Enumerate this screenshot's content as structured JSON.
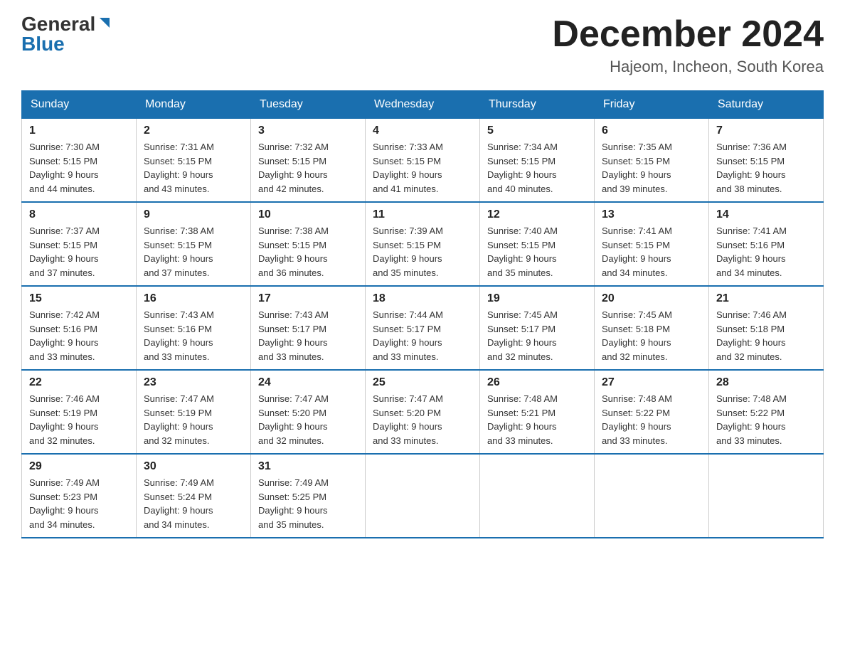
{
  "header": {
    "logo_general": "General",
    "logo_blue": "Blue",
    "month_year": "December 2024",
    "location": "Hajeom, Incheon, South Korea"
  },
  "weekdays": [
    "Sunday",
    "Monday",
    "Tuesday",
    "Wednesday",
    "Thursday",
    "Friday",
    "Saturday"
  ],
  "weeks": [
    [
      {
        "day": "1",
        "sunrise": "7:30 AM",
        "sunset": "5:15 PM",
        "daylight": "9 hours and 44 minutes."
      },
      {
        "day": "2",
        "sunrise": "7:31 AM",
        "sunset": "5:15 PM",
        "daylight": "9 hours and 43 minutes."
      },
      {
        "day": "3",
        "sunrise": "7:32 AM",
        "sunset": "5:15 PM",
        "daylight": "9 hours and 42 minutes."
      },
      {
        "day": "4",
        "sunrise": "7:33 AM",
        "sunset": "5:15 PM",
        "daylight": "9 hours and 41 minutes."
      },
      {
        "day": "5",
        "sunrise": "7:34 AM",
        "sunset": "5:15 PM",
        "daylight": "9 hours and 40 minutes."
      },
      {
        "day": "6",
        "sunrise": "7:35 AM",
        "sunset": "5:15 PM",
        "daylight": "9 hours and 39 minutes."
      },
      {
        "day": "7",
        "sunrise": "7:36 AM",
        "sunset": "5:15 PM",
        "daylight": "9 hours and 38 minutes."
      }
    ],
    [
      {
        "day": "8",
        "sunrise": "7:37 AM",
        "sunset": "5:15 PM",
        "daylight": "9 hours and 37 minutes."
      },
      {
        "day": "9",
        "sunrise": "7:38 AM",
        "sunset": "5:15 PM",
        "daylight": "9 hours and 37 minutes."
      },
      {
        "day": "10",
        "sunrise": "7:38 AM",
        "sunset": "5:15 PM",
        "daylight": "9 hours and 36 minutes."
      },
      {
        "day": "11",
        "sunrise": "7:39 AM",
        "sunset": "5:15 PM",
        "daylight": "9 hours and 35 minutes."
      },
      {
        "day": "12",
        "sunrise": "7:40 AM",
        "sunset": "5:15 PM",
        "daylight": "9 hours and 35 minutes."
      },
      {
        "day": "13",
        "sunrise": "7:41 AM",
        "sunset": "5:15 PM",
        "daylight": "9 hours and 34 minutes."
      },
      {
        "day": "14",
        "sunrise": "7:41 AM",
        "sunset": "5:16 PM",
        "daylight": "9 hours and 34 minutes."
      }
    ],
    [
      {
        "day": "15",
        "sunrise": "7:42 AM",
        "sunset": "5:16 PM",
        "daylight": "9 hours and 33 minutes."
      },
      {
        "day": "16",
        "sunrise": "7:43 AM",
        "sunset": "5:16 PM",
        "daylight": "9 hours and 33 minutes."
      },
      {
        "day": "17",
        "sunrise": "7:43 AM",
        "sunset": "5:17 PM",
        "daylight": "9 hours and 33 minutes."
      },
      {
        "day": "18",
        "sunrise": "7:44 AM",
        "sunset": "5:17 PM",
        "daylight": "9 hours and 33 minutes."
      },
      {
        "day": "19",
        "sunrise": "7:45 AM",
        "sunset": "5:17 PM",
        "daylight": "9 hours and 32 minutes."
      },
      {
        "day": "20",
        "sunrise": "7:45 AM",
        "sunset": "5:18 PM",
        "daylight": "9 hours and 32 minutes."
      },
      {
        "day": "21",
        "sunrise": "7:46 AM",
        "sunset": "5:18 PM",
        "daylight": "9 hours and 32 minutes."
      }
    ],
    [
      {
        "day": "22",
        "sunrise": "7:46 AM",
        "sunset": "5:19 PM",
        "daylight": "9 hours and 32 minutes."
      },
      {
        "day": "23",
        "sunrise": "7:47 AM",
        "sunset": "5:19 PM",
        "daylight": "9 hours and 32 minutes."
      },
      {
        "day": "24",
        "sunrise": "7:47 AM",
        "sunset": "5:20 PM",
        "daylight": "9 hours and 32 minutes."
      },
      {
        "day": "25",
        "sunrise": "7:47 AM",
        "sunset": "5:20 PM",
        "daylight": "9 hours and 33 minutes."
      },
      {
        "day": "26",
        "sunrise": "7:48 AM",
        "sunset": "5:21 PM",
        "daylight": "9 hours and 33 minutes."
      },
      {
        "day": "27",
        "sunrise": "7:48 AM",
        "sunset": "5:22 PM",
        "daylight": "9 hours and 33 minutes."
      },
      {
        "day": "28",
        "sunrise": "7:48 AM",
        "sunset": "5:22 PM",
        "daylight": "9 hours and 33 minutes."
      }
    ],
    [
      {
        "day": "29",
        "sunrise": "7:49 AM",
        "sunset": "5:23 PM",
        "daylight": "9 hours and 34 minutes."
      },
      {
        "day": "30",
        "sunrise": "7:49 AM",
        "sunset": "5:24 PM",
        "daylight": "9 hours and 34 minutes."
      },
      {
        "day": "31",
        "sunrise": "7:49 AM",
        "sunset": "5:25 PM",
        "daylight": "9 hours and 35 minutes."
      },
      null,
      null,
      null,
      null
    ]
  ],
  "labels": {
    "sunrise": "Sunrise:",
    "sunset": "Sunset:",
    "daylight": "Daylight:"
  }
}
